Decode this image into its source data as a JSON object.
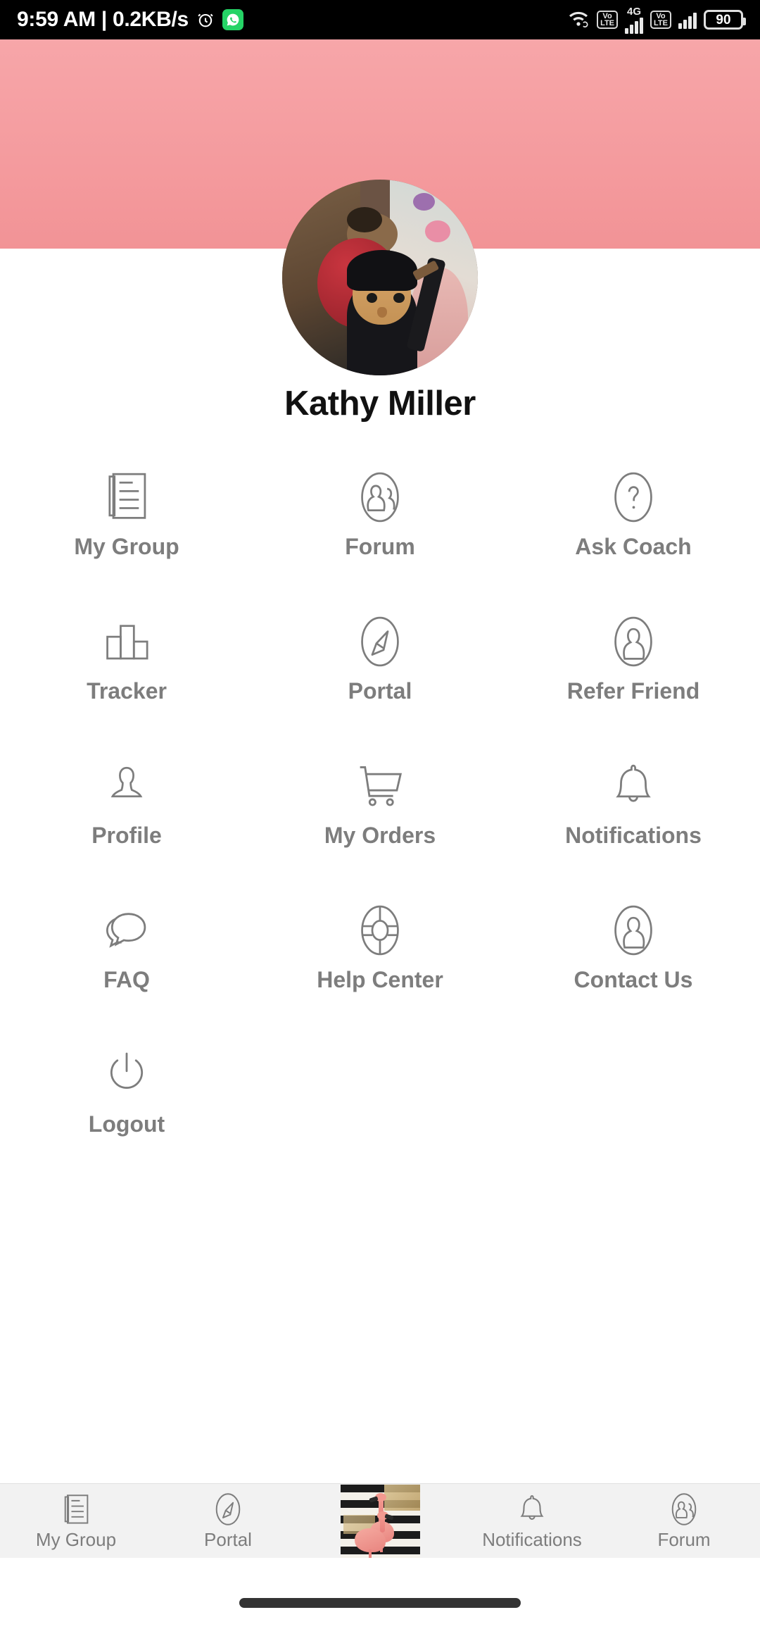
{
  "status_bar": {
    "clock": "9:59 AM | 0.2KB/s",
    "alarm_icon": "alarm-clock-icon",
    "whatsapp_icon": "whatsapp-icon",
    "wifi_icon": "wifi-icon",
    "volte_1": "VoLTE",
    "network_type": "4G",
    "volte_2": "VoLTE",
    "battery_level": "90"
  },
  "header": {
    "background_color": "#f29396",
    "avatar_name": "user-avatar-photo"
  },
  "profile": {
    "name": "Kathy Miller"
  },
  "menu": {
    "items": [
      {
        "label": "My Group",
        "icon": "document-list-icon"
      },
      {
        "label": "Forum",
        "icon": "two-people-circle-icon"
      },
      {
        "label": "Ask Coach",
        "icon": "question-mark-circle-icon"
      },
      {
        "label": "Tracker",
        "icon": "bar-chart-icon"
      },
      {
        "label": "Portal",
        "icon": "compass-icon"
      },
      {
        "label": "Refer Friend",
        "icon": "person-circle-icon"
      },
      {
        "label": "Profile",
        "icon": "person-icon"
      },
      {
        "label": "My Orders",
        "icon": "shopping-cart-icon"
      },
      {
        "label": "Notifications",
        "icon": "bell-icon"
      },
      {
        "label": "FAQ",
        "icon": "chat-bubbles-icon"
      },
      {
        "label": "Help Center",
        "icon": "life-ring-icon"
      },
      {
        "label": "Contact Us",
        "icon": "person-circle-icon"
      },
      {
        "label": "Logout",
        "icon": "power-icon"
      }
    ]
  },
  "bottom_nav": {
    "items": [
      {
        "label": "My Group",
        "icon": "document-list-icon"
      },
      {
        "label": "Portal",
        "icon": "compass-icon"
      },
      {
        "label": "",
        "icon": "flamingo-logo-icon"
      },
      {
        "label": "Notifications",
        "icon": "bell-icon"
      },
      {
        "label": "Forum",
        "icon": "two-people-circle-icon"
      }
    ]
  },
  "system": {
    "gesture_bar": "home-gesture-bar"
  },
  "colors": {
    "header_pink": "#f29396",
    "body_background": "#f7f7f7",
    "icon_gray": "#7d7d7d",
    "name_black": "#111111"
  }
}
